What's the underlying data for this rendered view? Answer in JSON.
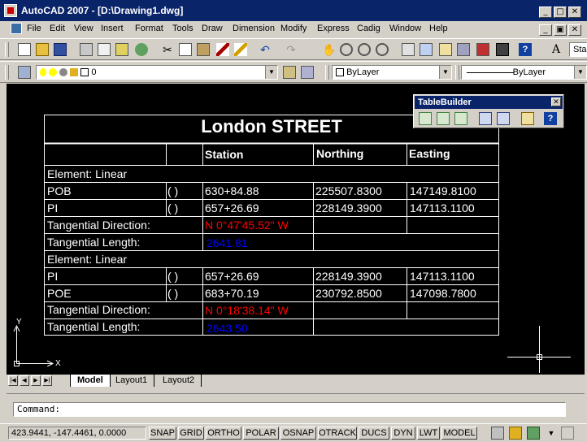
{
  "window": {
    "title": "AutoCAD 2007 - [D:\\Drawing1.dwg]"
  },
  "menu": [
    "File",
    "Edit",
    "View",
    "Insert",
    "Format",
    "Tools",
    "Draw",
    "Dimension",
    "Modify",
    "Express",
    "Cadig",
    "Window",
    "Help"
  ],
  "toolbar": {
    "style_value": "Sta"
  },
  "layer_toolbar": {
    "layer_value": "0",
    "color_value": "ByLayer",
    "linetype_value": "ByLayer"
  },
  "table_builder": {
    "title": "TableBuilder"
  },
  "table": {
    "title": "London STREET",
    "headers": [
      "Station",
      "Northing",
      "Easting"
    ],
    "rows": [
      {
        "type": "section",
        "label": "Element:  Linear"
      },
      {
        "type": "data",
        "label": "POB",
        "mark": "( )",
        "station": "630+84.88",
        "northing": "225507.8300",
        "easting": "147149.8100"
      },
      {
        "type": "data",
        "label": "PI",
        "mark": "( )",
        "station": "657+26.69",
        "northing": "228149.3900",
        "easting": "147113.1100"
      },
      {
        "type": "prop",
        "label": "Tangential Direction:",
        "value": "N 0°47'45.52\" W",
        "color": "#ff0000"
      },
      {
        "type": "prop",
        "label": "Tangential Length:",
        "value": "2641.81",
        "color": "#0000ff"
      },
      {
        "type": "section",
        "label": "Element:  Linear"
      },
      {
        "type": "data",
        "label": "PI",
        "mark": "( )",
        "station": "657+26.69",
        "northing": "228149.3900",
        "easting": "147113.1100"
      },
      {
        "type": "data",
        "label": "POE",
        "mark": "( )",
        "station": "683+70.19",
        "northing": "230792.8500",
        "easting": "147098.7800"
      },
      {
        "type": "prop",
        "label": "Tangential Direction:",
        "value": "N 0°18'38.14\" W",
        "color": "#ff0000"
      },
      {
        "type": "prop",
        "label": "Tangential Length:",
        "value": "2643.50",
        "color": "#0000ff"
      }
    ]
  },
  "ucs": {
    "x_label": "X",
    "y_label": "Y"
  },
  "layout_tabs": [
    "Model",
    "Layout1",
    "Layout2"
  ],
  "command": {
    "prompt": "Command:"
  },
  "status": {
    "coordinates": "423.9441, -147.4461, 0.0000",
    "buttons": [
      "SNAP",
      "GRID",
      "ORTHO",
      "POLAR",
      "OSNAP",
      "OTRACK",
      "DUCS",
      "DYN",
      "LWT",
      "MODEL"
    ]
  },
  "colors": {
    "background": "#000000",
    "lines": "#ffffff",
    "direction": "#ff0000",
    "length": "#0000ff",
    "titlebar": "#0a246a"
  }
}
